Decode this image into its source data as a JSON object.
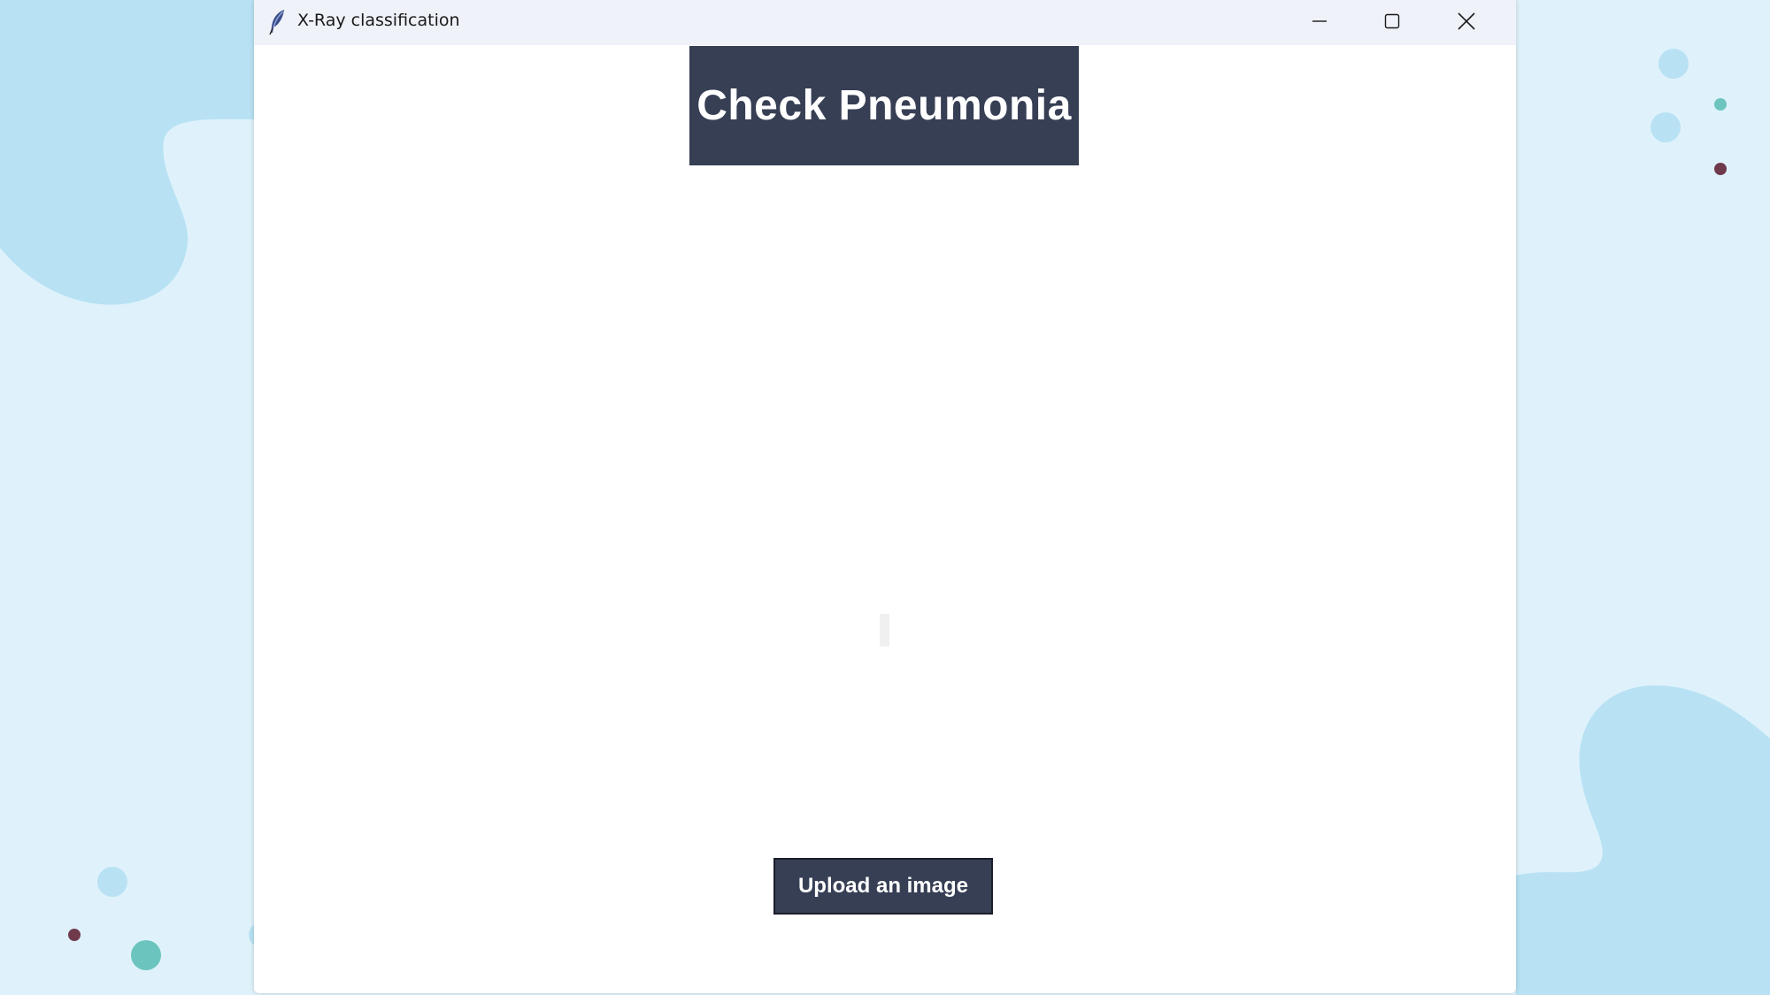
{
  "window": {
    "title": "X-Ray classification",
    "app_icon": "feather-icon",
    "controls": {
      "minimize_icon": "minimize-icon",
      "maximize_icon": "maximize-icon",
      "close_icon": "close-icon"
    }
  },
  "main": {
    "header_text": "Check Pneumonia",
    "upload_button_label": "Upload an image"
  },
  "colors": {
    "banner_bg": "#373f55",
    "button_bg": "#373f55",
    "titlebar_bg": "#eff2f9",
    "desktop_bg": "#dff2fb",
    "blob": "#b8e2f4"
  }
}
